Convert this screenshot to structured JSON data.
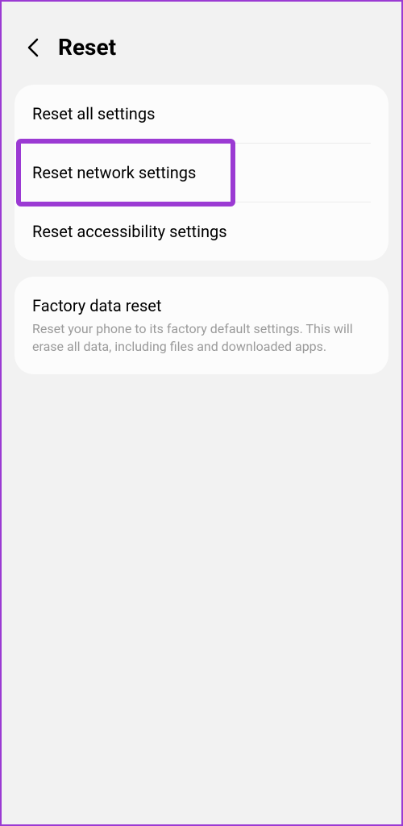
{
  "header": {
    "title": "Reset"
  },
  "section1": {
    "items": [
      {
        "label": "Reset all settings"
      },
      {
        "label": "Reset network settings",
        "highlighted": true
      },
      {
        "label": "Reset accessibility settings"
      }
    ]
  },
  "section2": {
    "title": "Factory data reset",
    "description": "Reset your phone to its factory default settings. This will erase all data, including files and downloaded apps."
  },
  "colors": {
    "accent": "#9b3ad3",
    "background": "#f2f2f2",
    "card": "#fcfcfc",
    "text": "#000",
    "muted": "#9a9a9a"
  }
}
